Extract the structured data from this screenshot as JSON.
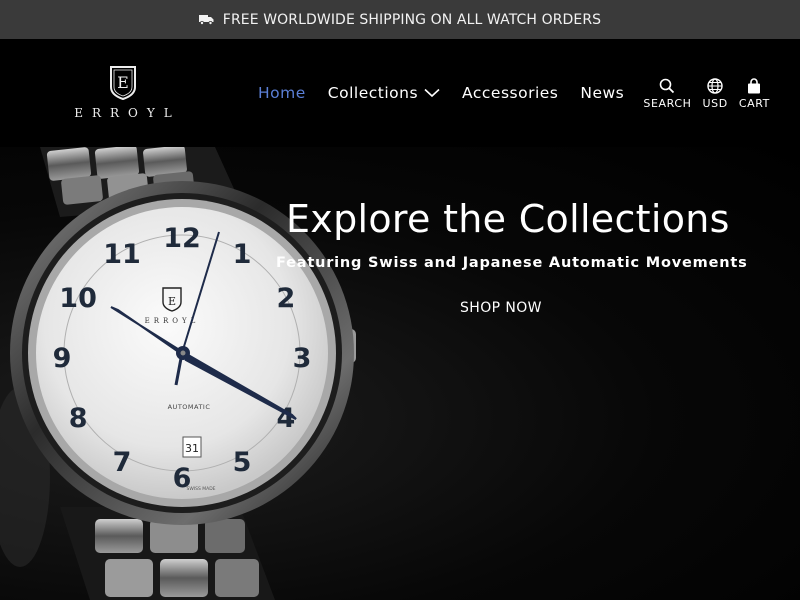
{
  "announcement": {
    "text": "FREE WORLDWIDE SHIPPING ON ALL WATCH ORDERS",
    "icon": "truck-icon"
  },
  "logo": {
    "letter": "E",
    "wordmark": "ERROYL"
  },
  "nav": {
    "items": [
      {
        "label": "Home",
        "active": true
      },
      {
        "label": "Collections",
        "has_dropdown": true
      },
      {
        "label": "Accessories"
      },
      {
        "label": "News"
      }
    ]
  },
  "tools": {
    "search": {
      "label": "SEARCH",
      "icon": "search-icon"
    },
    "currency": {
      "label": "USD",
      "icon": "globe-icon"
    },
    "cart": {
      "label": "CART",
      "icon": "bag-icon"
    }
  },
  "hero": {
    "title": "Explore the Collections",
    "subtitle": "Featuring Swiss and Japanese Automatic Movements",
    "cta": "SHOP NOW"
  },
  "watch": {
    "numerals": [
      "12",
      "1",
      "2",
      "3",
      "4",
      "5",
      "6",
      "7",
      "8",
      "9",
      "10",
      "11"
    ],
    "brand": "ERROYL",
    "logo_letter": "E",
    "model": "AUTOMATIC",
    "date": "31",
    "footer": "SWISS MADE"
  },
  "colors": {
    "accent": "#5b7fd6",
    "announce_bg": "#3a3a3a",
    "header_bg": "#000000"
  }
}
